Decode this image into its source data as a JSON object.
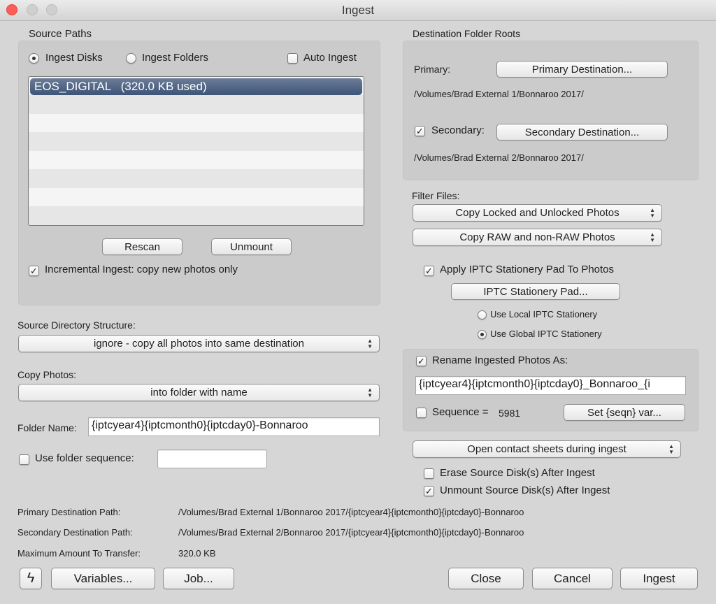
{
  "window": {
    "title": "Ingest"
  },
  "source_paths": {
    "heading": "Source Paths",
    "radio_ingest_disks": {
      "label": "Ingest Disks",
      "selected": true
    },
    "radio_ingest_folders": {
      "label": "Ingest Folders",
      "selected": false
    },
    "auto_ingest": {
      "label": "Auto Ingest",
      "checked": false
    },
    "list_items": [
      {
        "label": "EOS_DIGITAL   (320.0 KB used)",
        "selected": true
      }
    ],
    "rescan_label": "Rescan",
    "unmount_label": "Unmount",
    "incremental": {
      "label": "Incremental Ingest: copy new photos only",
      "checked": true
    }
  },
  "destination_roots": {
    "heading": "Destination Folder Roots",
    "primary_label": "Primary:",
    "primary_button": "Primary Destination...",
    "primary_path": "/Volumes/Brad External 1/Bonnaroo 2017/",
    "secondary": {
      "label": "Secondary:",
      "checked": true
    },
    "secondary_button": "Secondary Destination...",
    "secondary_path": "/Volumes/Brad External 2/Bonnaroo 2017/"
  },
  "filter_files": {
    "heading": "Filter Files:",
    "locked_popup": "Copy Locked and Unlocked Photos",
    "raw_popup": "Copy RAW and non-RAW Photos",
    "apply_iptc": {
      "label": "Apply IPTC Stationery Pad To Photos",
      "checked": true
    },
    "iptc_button": "IPTC Stationery Pad...",
    "use_local": {
      "label": "Use Local IPTC Stationery",
      "selected": false
    },
    "use_global": {
      "label": "Use Global IPTC Stationery",
      "selected": true
    }
  },
  "rename": {
    "checkbox": {
      "label": "Rename Ingested Photos As:",
      "checked": true
    },
    "value": "{iptcyear4}{iptcmonth0}{iptcday0}_Bonnaroo_{i",
    "sequence": {
      "label": "Sequence =",
      "checked": false,
      "value": "5981"
    },
    "set_seqn_button": "Set {seqn} var..."
  },
  "contact_sheets_popup": "Open contact sheets during ingest",
  "erase_source": {
    "label": "Erase Source Disk(s) After Ingest",
    "checked": false
  },
  "unmount_source": {
    "label": "Unmount Source Disk(s) After Ingest",
    "checked": true
  },
  "source_directory": {
    "heading": "Source Directory Structure:",
    "popup": "ignore - copy all photos into same destination"
  },
  "copy_photos": {
    "heading": "Copy Photos:",
    "popup": "into folder with name"
  },
  "folder_name": {
    "label": "Folder Name:",
    "value": "{iptcyear4}{iptcmonth0}{iptcday0}-Bonnaroo"
  },
  "folder_sequence": {
    "label": "Use folder sequence:",
    "checked": false,
    "value": ""
  },
  "summary": {
    "primary_label": "Primary Destination Path:",
    "primary_value": "/Volumes/Brad External 1/Bonnaroo 2017/{iptcyear4}{iptcmonth0}{iptcday0}-Bonnaroo",
    "secondary_label": "Secondary Destination Path:",
    "secondary_value": "/Volumes/Brad External 2/Bonnaroo 2017/{iptcyear4}{iptcmonth0}{iptcday0}-Bonnaroo",
    "max_label": "Maximum Amount To Transfer:",
    "max_value": "320.0 KB"
  },
  "footer": {
    "lightning_icon": "lightning-icon",
    "variables_label": "Variables...",
    "job_label": "Job...",
    "close_label": "Close",
    "cancel_label": "Cancel",
    "ingest_label": "Ingest"
  },
  "icons": {
    "check": "✓",
    "popup_arrows_up": "▲",
    "popup_arrows_down": "▼",
    "lightning": "ϟ"
  }
}
